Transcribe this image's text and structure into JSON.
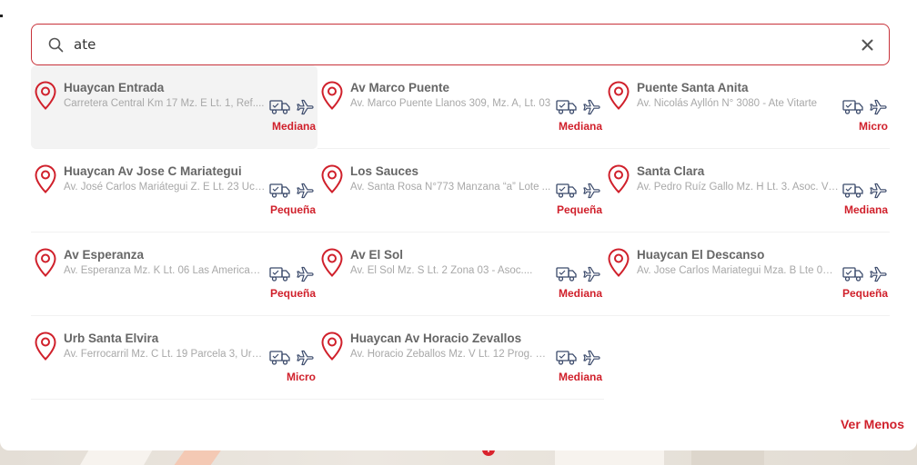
{
  "search": {
    "value": "ate",
    "placeholder": ""
  },
  "results": [
    {
      "name": "Huaycan Entrada",
      "address": "Carretera Central Km 17 Mz. E Lt. 1, Ref....",
      "size": "Mediana",
      "active": true
    },
    {
      "name": "Av Marco Puente",
      "address": "Av. Marco Puente Llanos 309, Mz. A, Lt. 03",
      "size": "Mediana"
    },
    {
      "name": "Puente Santa Anita",
      "address": "Av. Nicolás Ayllón N° 3080 - Ate Vitarte",
      "size": "Micro"
    },
    {
      "name": "Huaycan Av Jose C Mariategui",
      "address": "Av. José Carlos Mariátegui Z. E Lt. 23 Ucv....",
      "size": "Pequeña"
    },
    {
      "name": "Los Sauces",
      "address": "Av. Santa Rosa N°773 Manzana “a” Lote ...",
      "size": "Pequeña"
    },
    {
      "name": "Santa Clara",
      "address": "Av. Pedro Ruíz Gallo Mz. H Lt. 3. Asoc. Viv....",
      "size": "Mediana"
    },
    {
      "name": "Av Esperanza",
      "address": "Av. Esperanza Mz. K Lt. 06 Las Americas ...",
      "size": "Pequeña"
    },
    {
      "name": "Av El Sol",
      "address": "Av. El Sol Mz. S Lt. 2 Zona 03 - Asoc....",
      "size": "Mediana"
    },
    {
      "name": "Huaycan El Descanso",
      "address": "Av. Jose Carlos Mariategui Mza. B Lte 06,...",
      "size": "Pequeña"
    },
    {
      "name": "Urb Santa Elvira",
      "address": "Av. Ferrocarril Mz. C Lt. 19 Parcela 3, Urb....",
      "size": "Micro"
    },
    {
      "name": "Huaycan Av Horacio Zevallos",
      "address": "Av. Horacio Zeballos Mz. V Lt. 12 Prog. Vi...",
      "size": "Mediana"
    }
  ],
  "icons": {
    "delivery": "delivery-truck-icon",
    "shipping": "airplane-icon",
    "location": "location-pin-icon"
  },
  "colors": {
    "accent": "#d0202b",
    "border": "#c8323a"
  },
  "footer": {
    "toggle_label": "Ver Menos"
  }
}
